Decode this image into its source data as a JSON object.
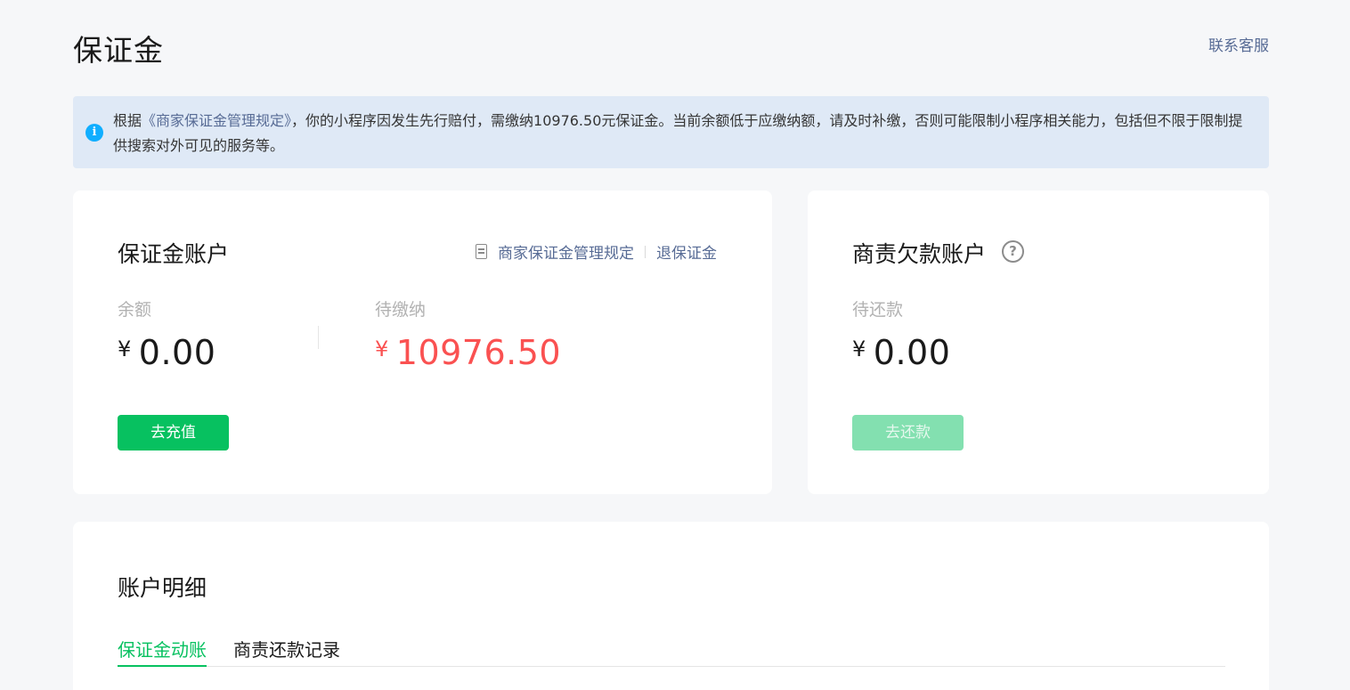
{
  "page": {
    "title": "保证金",
    "contact_link": "联系客服"
  },
  "notice": {
    "icon": "info-icon",
    "prefix": "根据",
    "link_text": "《商家保证金管理规定》",
    "body": "，你的小程序因发生先行赔付，需缴纳10976.50元保证金。当前余额低于应缴纳额，请及时补缴，否则可能限制小程序相关能力，包括但不限于限制提供搜索对外可见的服务等。"
  },
  "deposit_account": {
    "title": "保证金账户",
    "rules_link": "商家保证金管理规定",
    "refund_link": "退保证金",
    "balance_label": "余额",
    "balance_currency": "¥",
    "balance_value": "0.00",
    "payable_label": "待缴纳",
    "payable_currency": "¥",
    "payable_value": "10976.50",
    "recharge_button": "去充值"
  },
  "debt_account": {
    "title": "商责欠款账户",
    "help_icon": "question-circle-icon",
    "repay_label": "待还款",
    "repay_currency": "¥",
    "repay_value": "0.00",
    "repay_button": "去还款"
  },
  "account_details": {
    "title": "账户明细",
    "tabs": [
      {
        "label": "保证金动账",
        "active": true
      },
      {
        "label": "商责还款记录",
        "active": false
      }
    ]
  },
  "colors": {
    "accent_green": "#07c160",
    "link_blue": "#576b95",
    "amount_red": "#fa5151",
    "notice_bg": "#dfe9f6"
  }
}
